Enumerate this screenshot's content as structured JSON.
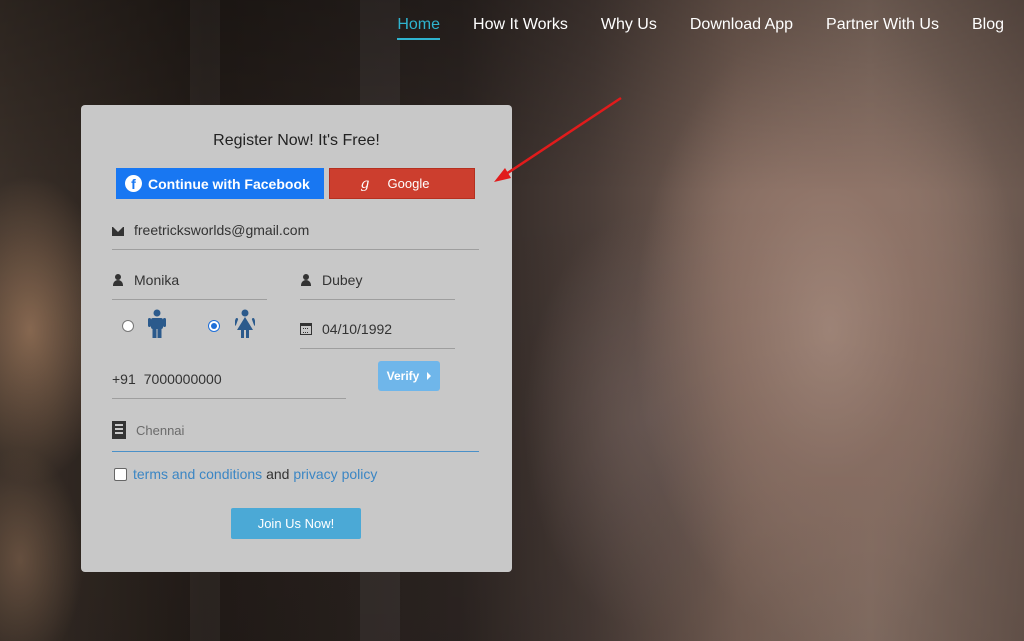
{
  "nav": {
    "items": [
      {
        "label": "Home",
        "active": true
      },
      {
        "label": "How It Works"
      },
      {
        "label": "Why Us"
      },
      {
        "label": "Download App"
      },
      {
        "label": "Partner With Us"
      },
      {
        "label": "Blog"
      }
    ]
  },
  "form": {
    "title": "Register Now! It's Free!",
    "facebook_label": "Continue with Facebook",
    "facebook_icon": "f",
    "google_label": "Google",
    "google_icon": "g",
    "email": "freetricksworlds@gmail.com",
    "first_name": "Monika",
    "last_name": "Dubey",
    "gender": "female",
    "dob": "04/10/1992",
    "phone_code": "+91",
    "phone": "7000000000",
    "verify_label": "Verify",
    "city_placeholder": "Chennai",
    "terms_link": "terms and conditions",
    "terms_and": "and",
    "privacy_link": "privacy policy",
    "join_label": "Join Us Now!"
  },
  "colors": {
    "accent": "#2fb3ce",
    "facebook": "#1877f2",
    "google": "#cc3e2e",
    "annotation_arrow": "#e11b1b"
  }
}
